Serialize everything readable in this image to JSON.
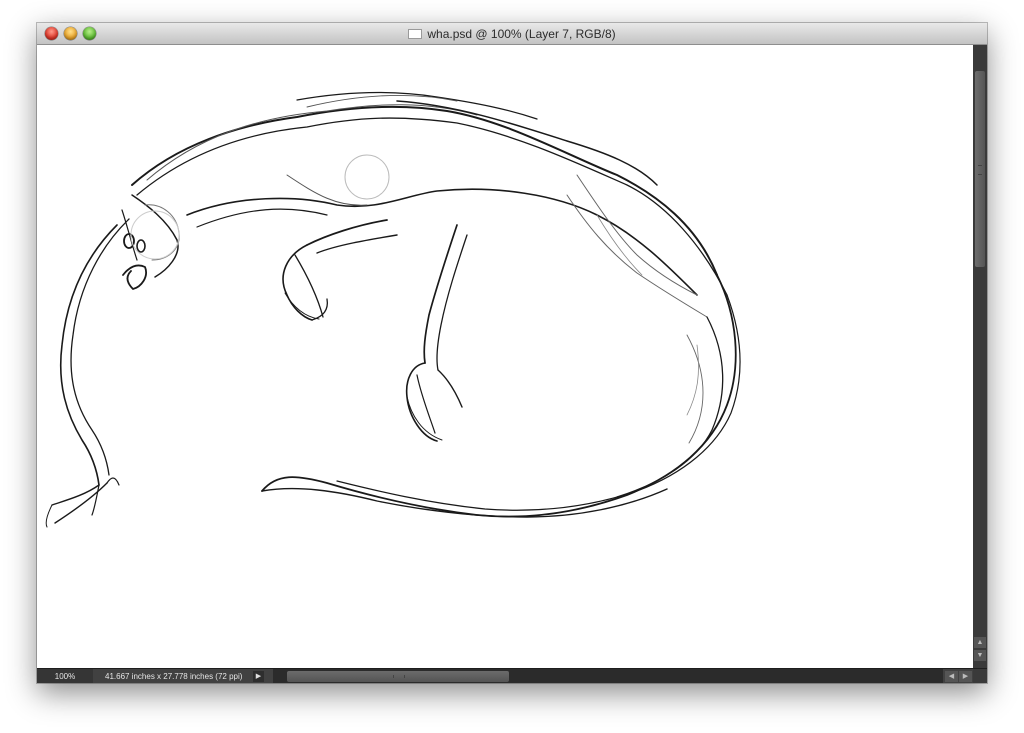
{
  "window": {
    "title": "wha.psd @ 100% (Layer 7, RGB/8)",
    "buttons": {
      "close": "close-button",
      "minimize": "minimize-button",
      "zoom": "zoom-button"
    }
  },
  "status": {
    "zoom": "100%",
    "document_info": "41.667 inches x 27.778 inches (72 ppi)",
    "menu_arrow": "▶"
  },
  "scrollbars": {
    "up_arrow": "▲",
    "down_arrow": "▼",
    "left_arrow": "◀",
    "right_arrow": "▶"
  },
  "canvas": {
    "background": "#ffffff",
    "stroke_color": "#1a1a1a",
    "content": "sketch-drawing"
  },
  "colors": {
    "close": "#e0382a",
    "minimize": "#eba52a",
    "zoom": "#5fbd33",
    "statusbar": "#414141"
  }
}
